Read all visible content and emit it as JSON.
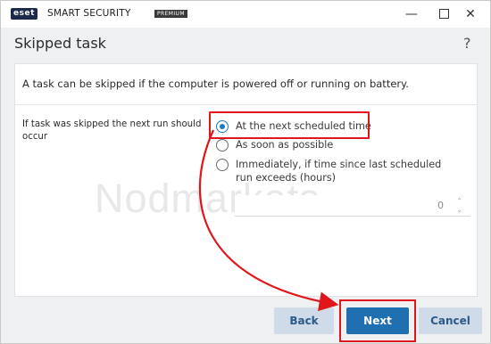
{
  "titlebar": {
    "logo": "eset",
    "product": "SMART SECURITY",
    "edition": "PREMIUM",
    "minimize_icon": "minimize-icon",
    "maximize_icon": "maximize-icon",
    "close_icon": "close-icon",
    "close_glyph": "✕",
    "minimize_glyph": "—"
  },
  "header": {
    "title": "Skipped task",
    "help": "?"
  },
  "content": {
    "description": "A task can be skipped if the computer is powered off or running on battery.",
    "setting_label": "If task was skipped the next run should occur",
    "options": [
      {
        "label": "At the next scheduled time",
        "checked": true
      },
      {
        "label": "As soon as possible",
        "checked": false
      },
      {
        "label": "Immediately, if time since last scheduled run exceeds (hours)",
        "checked": false
      }
    ],
    "spinner_value": "0",
    "spinner_up": "⌃",
    "spinner_down": "⌄",
    "watermark": "Nodmarkets"
  },
  "footer": {
    "back_label": "Back",
    "next_label": "Next",
    "cancel_label": "Cancel"
  },
  "colors": {
    "accent": "#1f6fb1",
    "highlight": "#e0161b",
    "secondary_button": "#cfdbe8"
  }
}
